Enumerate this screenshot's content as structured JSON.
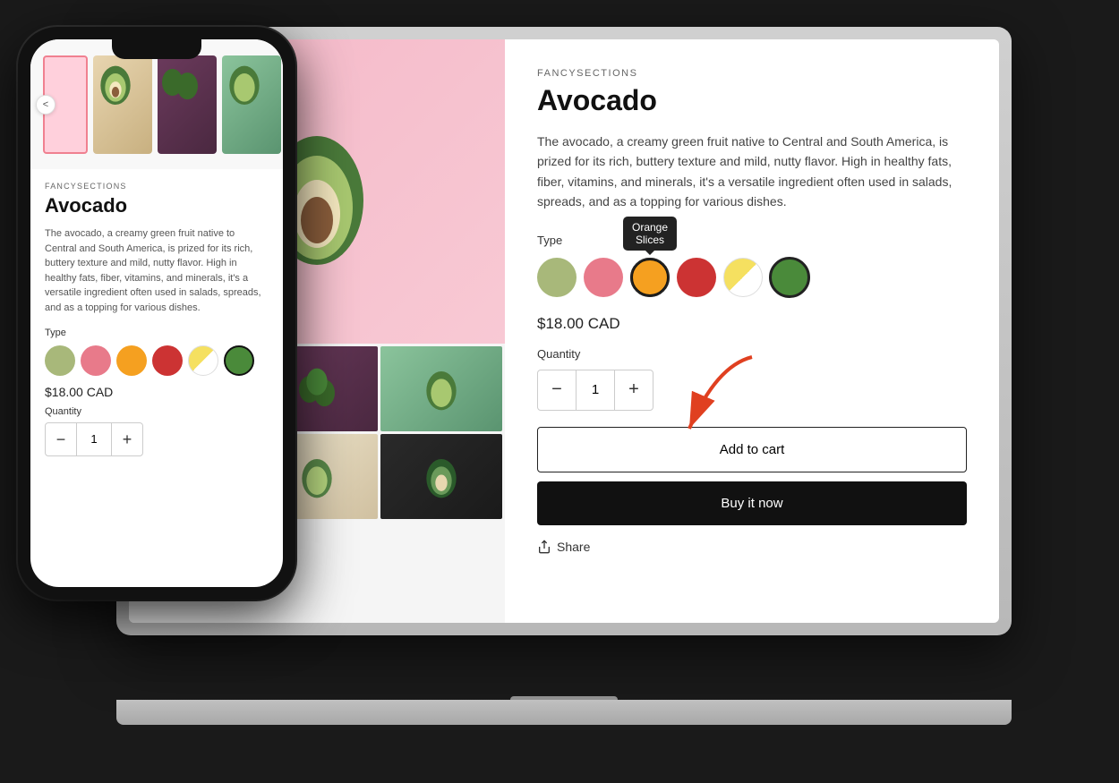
{
  "brand": "FANCYSECTIONS",
  "product": {
    "name": "Avocado",
    "description": "The avocado, a creamy green fruit native to Central and South America, is prized for its rich, buttery texture and mild, nutty flavor. High in healthy fats, fiber, vitamins, and minerals, it's a versatile ingredient often used in salads, spreads, and as a topping for various dishes.",
    "description_mobile": "The avocado, a creamy green fruit native to Central and South America, is prized for its rich, buttery texture and mild, nutty flavor. High in healthy fats, fiber, vitamins, and minerals, it's a versatile ingredient often used in salads, spreads, and as a topping for various dishes.",
    "price": "$18.00 CAD",
    "quantity": "1",
    "type_label": "Type",
    "quantity_label": "Quantity"
  },
  "swatches": [
    {
      "id": "sage",
      "label": "Sage"
    },
    {
      "id": "pink",
      "label": "Pink"
    },
    {
      "id": "orange",
      "label": "Orange Slices",
      "selected": true
    },
    {
      "id": "red",
      "label": "Red"
    },
    {
      "id": "yellow",
      "label": "Yellow"
    },
    {
      "id": "green",
      "label": "Green"
    }
  ],
  "tooltip": {
    "text": "Orange\nSlices"
  },
  "buttons": {
    "add_to_cart": "Add to cart",
    "buy_it_now": "Buy it now",
    "share": "Share",
    "prev": "<"
  },
  "qty_controls": {
    "decrease": "−",
    "increase": "+"
  },
  "thumbs": [
    {
      "id": 1
    },
    {
      "id": 2
    },
    {
      "id": 3
    },
    {
      "id": 4
    },
    {
      "id": 5
    },
    {
      "id": 6
    }
  ]
}
